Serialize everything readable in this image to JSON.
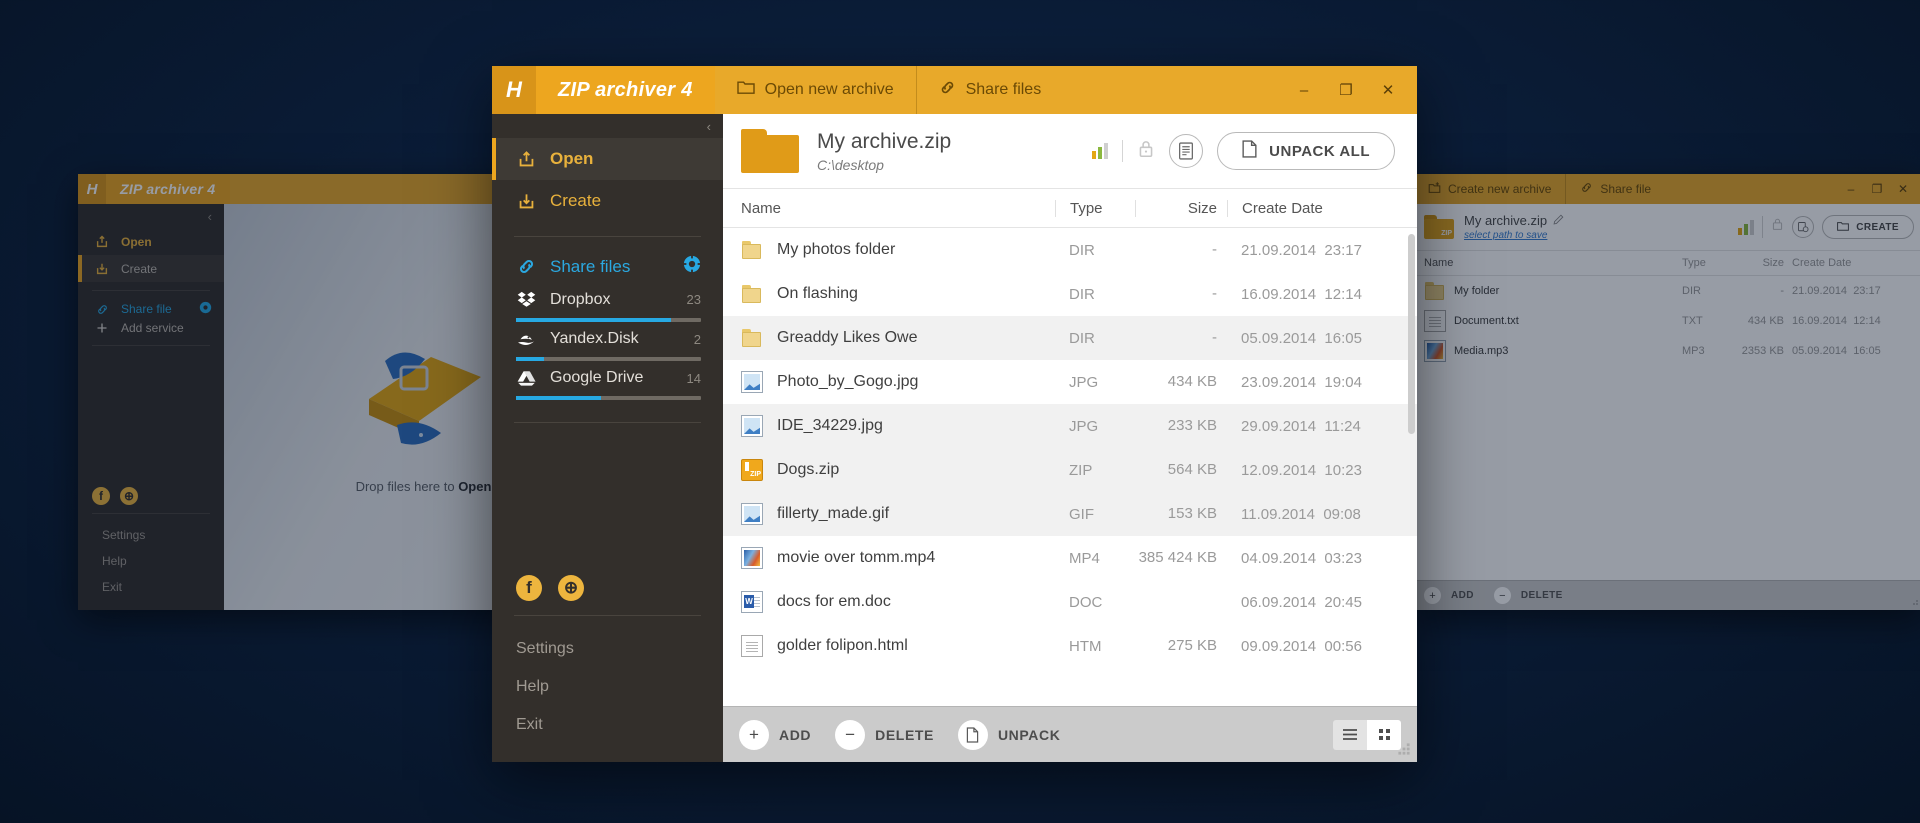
{
  "main_window": {
    "brand": "ZIP archiver 4",
    "logo_letter": "H",
    "tabs": [
      {
        "label": "Open new archive",
        "icon": "folder-outline-icon"
      },
      {
        "label": "Share files",
        "icon": "link-icon"
      }
    ],
    "window_controls": {
      "minimize": "–",
      "maximize": "❐",
      "close": "✕"
    },
    "sidebar": {
      "collapse": "‹",
      "nav": [
        {
          "label": "Open",
          "icon": "open-archive-icon",
          "active": true
        },
        {
          "label": "Create",
          "icon": "create-archive-icon",
          "active": false
        }
      ],
      "share_header": {
        "label": "Share files",
        "icon": "link-icon",
        "gear": "gear-icon"
      },
      "services": [
        {
          "name": "Dropbox",
          "count": "23",
          "progress": 84
        },
        {
          "name": "Yandex.Disk",
          "count": "2",
          "progress": 15
        },
        {
          "name": "Google Drive",
          "count": "14",
          "progress": 46
        }
      ],
      "social": [
        {
          "name": "facebook-icon",
          "glyph": "f"
        },
        {
          "name": "globe-icon",
          "glyph": "⊕"
        }
      ],
      "footer": [
        "Settings",
        "Help",
        "Exit"
      ]
    },
    "archive": {
      "name": "My archive.zip",
      "path": "C:\\desktop",
      "tools": {
        "compression_icon": "bar-chart-icon",
        "lock_icon": "lock-icon",
        "comment_icon": "archive-comment-icon"
      },
      "unpack_all_label": "UNPACK ALL",
      "unpack_all_icon": "file-icon"
    },
    "table": {
      "columns": [
        "Name",
        "Type",
        "Size",
        "Create Date"
      ],
      "rows": [
        {
          "name": "My photos folder",
          "type": "DIR",
          "size": "-",
          "date": "21.09.2014",
          "time": "23:17",
          "icon": "folder-icon",
          "alt": false
        },
        {
          "name": "On flashing",
          "type": "DIR",
          "size": "-",
          "date": "16.09.2014",
          "time": "12:14",
          "icon": "folder-icon",
          "alt": false
        },
        {
          "name": "Greaddy Likes Owe",
          "type": "DIR",
          "size": "-",
          "date": "05.09.2014",
          "time": "16:05",
          "icon": "folder-icon",
          "alt": true
        },
        {
          "name": "Photo_by_Gogo.jpg",
          "type": "JPG",
          "size": "434 KB",
          "date": "23.09.2014",
          "time": "19:04",
          "icon": "image-icon",
          "alt": false
        },
        {
          "name": "IDE_34229.jpg",
          "type": "JPG",
          "size": "233 KB",
          "date": "29.09.2014",
          "time": "11:24",
          "icon": "image-icon",
          "alt": true
        },
        {
          "name": "Dogs.zip",
          "type": "ZIP",
          "size": "564 KB",
          "date": "12.09.2014",
          "time": "10:23",
          "icon": "zip-icon",
          "alt": true
        },
        {
          "name": "fillerty_made.gif",
          "type": "GIF",
          "size": "153 KB",
          "date": "11.09.2014",
          "time": "09:08",
          "icon": "image-icon",
          "alt": true
        },
        {
          "name": "movie over tomm.mp4",
          "type": "MP4",
          "size": "385 424 KB",
          "date": "04.09.2014",
          "time": "03:23",
          "icon": "video-icon",
          "alt": false
        },
        {
          "name": "docs for em.doc",
          "type": "DOC",
          "size": "",
          "date": "06.09.2014",
          "time": "20:45",
          "icon": "word-doc-icon",
          "alt": false
        },
        {
          "name": "golder folipon.html",
          "type": "HTM",
          "size": "275 KB",
          "date": "09.09.2014",
          "time": "00:56",
          "icon": "html-file-icon",
          "alt": false
        }
      ]
    },
    "bottombar": {
      "actions": [
        {
          "label": "ADD",
          "glyph": "+",
          "icon": "plus-icon"
        },
        {
          "label": "DELETE",
          "glyph": "−",
          "icon": "minus-icon"
        },
        {
          "label": "UNPACK",
          "glyph": "❐",
          "icon": "file-icon"
        }
      ],
      "view_list_icon": "list-view-icon",
      "view_grid_icon": "grid-view-icon"
    }
  },
  "left_window": {
    "brand": "ZIP archiver 4",
    "logo_letter": "H",
    "collapse": "‹",
    "nav": [
      {
        "label": "Open",
        "icon": "open-archive-icon",
        "active": false
      },
      {
        "label": "Create",
        "icon": "create-archive-icon",
        "active": true
      }
    ],
    "share_header": {
      "label": "Share file",
      "icon": "link-icon",
      "gear": "gear-icon"
    },
    "add_service": {
      "label": "Add service",
      "icon": "plus-icon"
    },
    "social": [
      {
        "name": "facebook-icon",
        "glyph": "f"
      },
      {
        "name": "globe-icon",
        "glyph": "⊕"
      }
    ],
    "footer": [
      "Settings",
      "Help",
      "Exit"
    ],
    "drop_hint_prefix": "Drop files here to ",
    "drop_hint_bold": "Open"
  },
  "right_window": {
    "tabs": [
      {
        "label": "Create new archive",
        "icon": "new-archive-icon"
      },
      {
        "label": "Share file",
        "icon": "link-icon"
      }
    ],
    "window_controls": {
      "minimize": "–",
      "maximize": "❐",
      "close": "✕"
    },
    "archive": {
      "name": "My archive.zip",
      "edit_icon": "pencil-icon",
      "sub_link": "select path to save",
      "create_label": "CREATE",
      "create_icon": "folder-outline-icon"
    },
    "columns": [
      "Name",
      "Type",
      "Size",
      "Create Date"
    ],
    "rows": [
      {
        "name": "My folder",
        "type": "DIR",
        "size": "-",
        "date": "21.09.2014",
        "time": "23:17",
        "icon": "folder-icon"
      },
      {
        "name": "Document.txt",
        "type": "TXT",
        "size": "434 KB",
        "date": "16.09.2014",
        "time": "12:14",
        "icon": "text-file-icon"
      },
      {
        "name": "Media.mp3",
        "type": "MP3",
        "size": "2353 KB",
        "date": "05.09.2014",
        "time": "16:05",
        "icon": "audio-file-icon"
      }
    ],
    "bottombar": {
      "actions": [
        {
          "label": "ADD",
          "glyph": "+",
          "icon": "plus-icon"
        },
        {
          "label": "DELETE",
          "glyph": "−",
          "icon": "minus-icon"
        }
      ]
    }
  },
  "colors": {
    "brand_orange": "#eda61f",
    "brand_orange_dark": "#d89419",
    "sidebar_dark": "#332f2b",
    "accent_blue": "#27a9e3",
    "accent_gold": "#e8b13c",
    "desktop_blue": "#0b1d38"
  }
}
